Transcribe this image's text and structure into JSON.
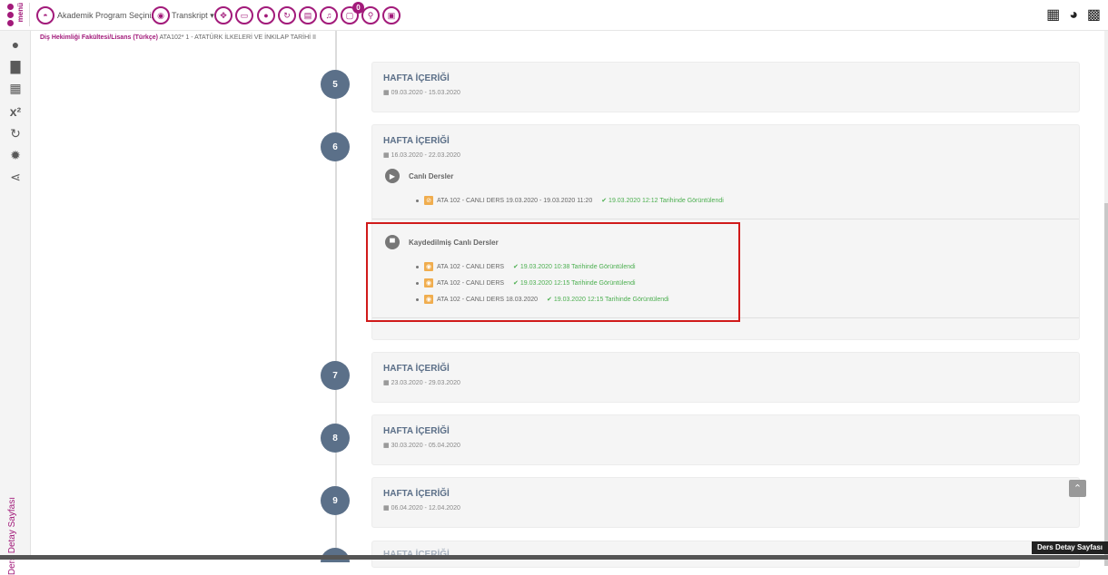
{
  "topbar": {
    "menu_label": "menü",
    "program_label": "Akademik Program Seçiniz",
    "transcript_label": "Transkript",
    "notif_count": "0"
  },
  "breadcrumb": {
    "faculty": "Diş Hekimliği Fakültesi/Lisans (Türkçe)",
    "course": " ATA102* 1 - ATATÜRK İLKELERİ VE İNKILAP TARİHİ II"
  },
  "sidebar": {
    "vertical_label": "Ders Detay Sayfası"
  },
  "weeks": [
    {
      "num": "5",
      "title": "HAFTA İÇERİĞİ",
      "date": "09.03.2020 - 15.03.2020"
    },
    {
      "num": "6",
      "title": "HAFTA İÇERİĞİ",
      "date": "16.03.2020 - 22.03.2020"
    },
    {
      "num": "7",
      "title": "HAFTA İÇERİĞİ",
      "date": "23.03.2020 - 29.03.2020"
    },
    {
      "num": "8",
      "title": "HAFTA İÇERİĞİ",
      "date": "30.03.2020 - 05.04.2020"
    },
    {
      "num": "9",
      "title": "HAFTA İÇERİĞİ",
      "date": "06.04.2020 - 12.04.2020"
    },
    {
      "num": "",
      "title": "HAFTA İÇERİĞİ",
      "date": ""
    }
  ],
  "live": {
    "title": "Canlı Dersler",
    "item": {
      "name": "ATA 102 - CANLI DERS 19.03.2020 - 19.03.2020 11:20",
      "seen": "19.03.2020 12:12 Tarihinde Görüntülendi"
    }
  },
  "recorded": {
    "title": "Kaydedilmiş Canlı Dersler",
    "items": [
      {
        "name": "ATA 102 - CANLI DERS",
        "seen": "19.03.2020 10:38 Tarihinde Görüntülendi"
      },
      {
        "name": "ATA 102 - CANLI DERS",
        "seen": "19.03.2020 12:15 Tarihinde Görüntülendi"
      },
      {
        "name": "ATA 102 - CANLI DERS 18.03.2020",
        "seen": "19.03.2020 12:15 Tarihinde Görüntülendi"
      }
    ]
  },
  "footer_label": "Ders Detay Sayfası",
  "colors": {
    "brand": "#a21a7a",
    "week_circle": "#5b7089",
    "seen": "#4caf50",
    "highlight": "#d01a1a"
  }
}
